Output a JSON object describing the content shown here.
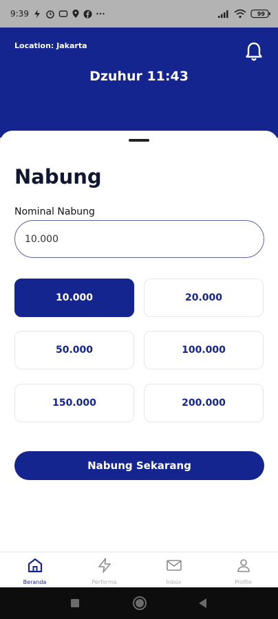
{
  "status_bar": {
    "time": "9:39",
    "battery": "99",
    "notification_icons": [
      "bolt-icon",
      "alarm-icon",
      "message-icon",
      "location-icon",
      "facebook-icon",
      "more-icon"
    ]
  },
  "header": {
    "location": "Location: Jakarta",
    "prayer_time": "Dzuhur 11:43"
  },
  "form": {
    "title": "Nabung",
    "field_label": "Nominal Nabung",
    "input_value": "10.000",
    "options": [
      "10.000",
      "20.000",
      "50.000",
      "100.000",
      "150.000",
      "200.000"
    ],
    "selected_option": "10.000",
    "submit_label": "Nabung Sekarang"
  },
  "bottom_nav": {
    "items": [
      {
        "label": "Beranda",
        "icon": "home-icon",
        "active": true
      },
      {
        "label": "Performa",
        "icon": "lightning-icon",
        "active": false
      },
      {
        "label": "Inbox",
        "icon": "mail-icon",
        "active": false
      },
      {
        "label": "Profile",
        "icon": "user-icon",
        "active": false
      }
    ]
  },
  "colors": {
    "primary": "#14258f",
    "background": "#ffffff",
    "text_dark": "#111632"
  }
}
